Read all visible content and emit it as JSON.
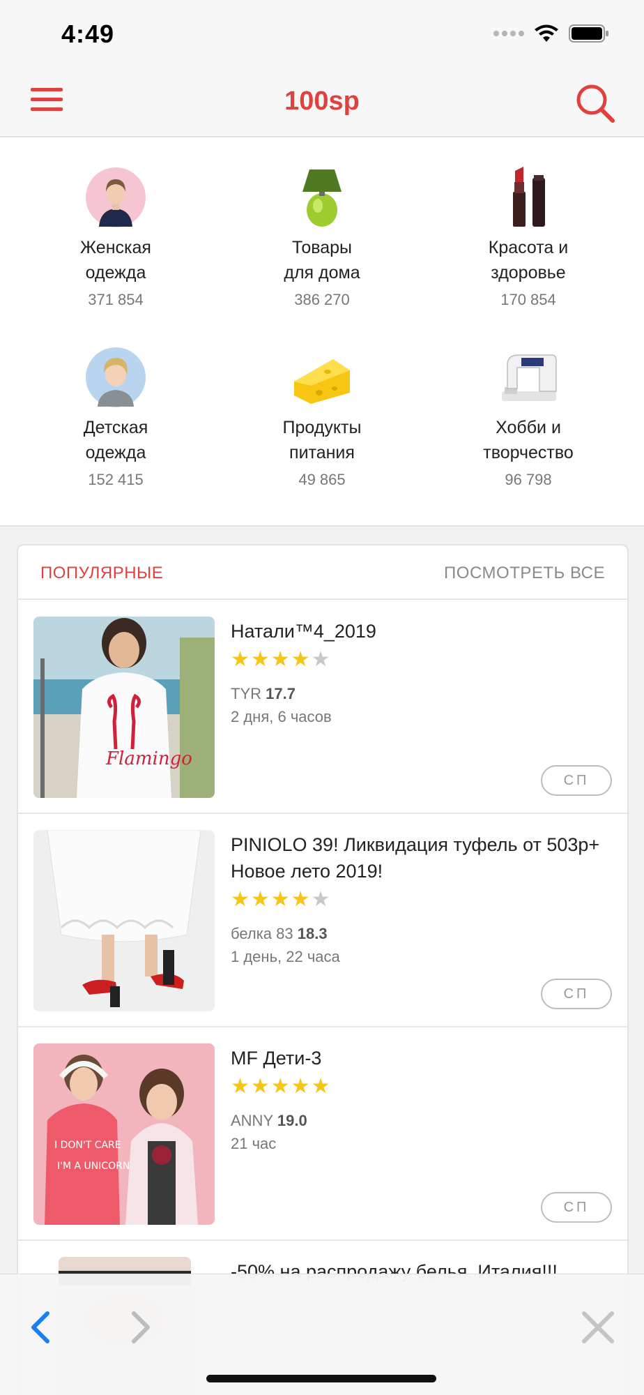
{
  "status_bar": {
    "time": "4:49"
  },
  "nav": {
    "title": "100sp"
  },
  "categories": [
    {
      "label": "Женская\nодежда",
      "count": "371 854",
      "icon": "woman-photo"
    },
    {
      "label": "Товары\nдля дома",
      "count": "386 270",
      "icon": "lamp-photo"
    },
    {
      "label": "Красота и\nздоровье",
      "count": "170 854",
      "icon": "lipstick-photo"
    },
    {
      "label": "Детская\nодежда",
      "count": "152 415",
      "icon": "child-photo"
    },
    {
      "label": "Продукты\nпитания",
      "count": "49 865",
      "icon": "cheese-photo"
    },
    {
      "label": "Хобби и\nтворчество",
      "count": "96 798",
      "icon": "sewing-machine-photo"
    }
  ],
  "popular": {
    "title": "ПОПУЛЯРНЫЕ",
    "see_all": "ПОСМОТРЕТЬ ВСЕ",
    "items": [
      {
        "title": "Натали™4_2019",
        "rating": 4.5,
        "seller": "TYR",
        "seller_rating": "17.7",
        "time_left": "2 дня, 6 часов",
        "button": "СП"
      },
      {
        "title": "PINIOLO 39! Ликвидация туфель от 503р+ Новое лето 2019!",
        "rating": 4.5,
        "seller": "белка 83",
        "seller_rating": "18.3",
        "time_left": "1 день, 22 часа",
        "button": "СП"
      },
      {
        "title": "MF Дети-3",
        "rating": 5,
        "seller": "ANNY",
        "seller_rating": "19.0",
        "time_left": "21 час",
        "button": "СП"
      },
      {
        "title": "-50% на распродажу белья. Италия!!!",
        "rating": 0,
        "seller": "",
        "seller_rating": "",
        "time_left": "",
        "button": ""
      }
    ]
  },
  "colors": {
    "accent": "#e0413e",
    "star": "#f5c518",
    "link_blue": "#1a7ef2"
  }
}
